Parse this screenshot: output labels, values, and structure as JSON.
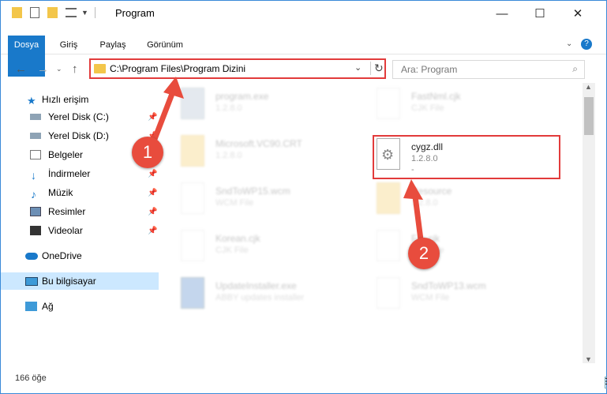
{
  "window": {
    "title": "Program",
    "minimize_icon": "minimize-icon",
    "maximize_icon": "maximize-icon",
    "close_icon": "close-icon"
  },
  "ribbon": {
    "tabs": [
      "Dosya",
      "Giriş",
      "Paylaş",
      "Görünüm"
    ]
  },
  "address": {
    "path": "C:\\Program Files\\Program Dizini",
    "search_placeholder": "Ara: Program"
  },
  "nav": {
    "items": [
      {
        "label": "Hızlı erişim",
        "icon": "star-icon",
        "pinned": false
      },
      {
        "label": "Yerel Disk (C:)",
        "icon": "drive-icon",
        "pinned": true
      },
      {
        "label": "Yerel Disk (D:)",
        "icon": "drive-icon",
        "pinned": true
      },
      {
        "label": "Belgeler",
        "icon": "documents-icon",
        "pinned": true
      },
      {
        "label": "İndirmeler",
        "icon": "download-icon",
        "pinned": true
      },
      {
        "label": "Müzik",
        "icon": "music-icon",
        "pinned": true
      },
      {
        "label": "Resimler",
        "icon": "pictures-icon",
        "pinned": true
      },
      {
        "label": "Videolar",
        "icon": "videos-icon",
        "pinned": true
      },
      {
        "label": "OneDrive",
        "icon": "cloud-icon",
        "pinned": false
      },
      {
        "label": "Bu bilgisayar",
        "icon": "computer-icon",
        "pinned": false
      },
      {
        "label": "Ağ",
        "icon": "network-icon",
        "pinned": false
      }
    ]
  },
  "files": {
    "left": [
      {
        "name": "program.exe",
        "sub": "1.2.8.0"
      },
      {
        "name": "Microsoft.VC90.CRT",
        "sub": "1.2.8.0"
      },
      {
        "name": "SndToWP15.wcm",
        "sub": "WCM File"
      },
      {
        "name": "Korean.cjk",
        "sub": "CJK File"
      },
      {
        "name": "UpdateInstaller.exe",
        "sub": "ABBY updates installer"
      }
    ],
    "right": [
      {
        "name": "FastNml.cjk",
        "sub": "CJK File"
      },
      {
        "name": "cygz.dll",
        "sub": "1.2.8.0",
        "extra": "-"
      },
      {
        "name": "Resource",
        "sub": "1.2.8.0"
      },
      {
        "name": "Fre.cjk",
        "sub": "CJK File"
      },
      {
        "name": "SndToWP13.wcm",
        "sub": "WCM File"
      }
    ]
  },
  "status": {
    "count": "166 öğe"
  },
  "annotations": {
    "step1": "1",
    "step2": "2",
    "color": "#e84c3d"
  }
}
